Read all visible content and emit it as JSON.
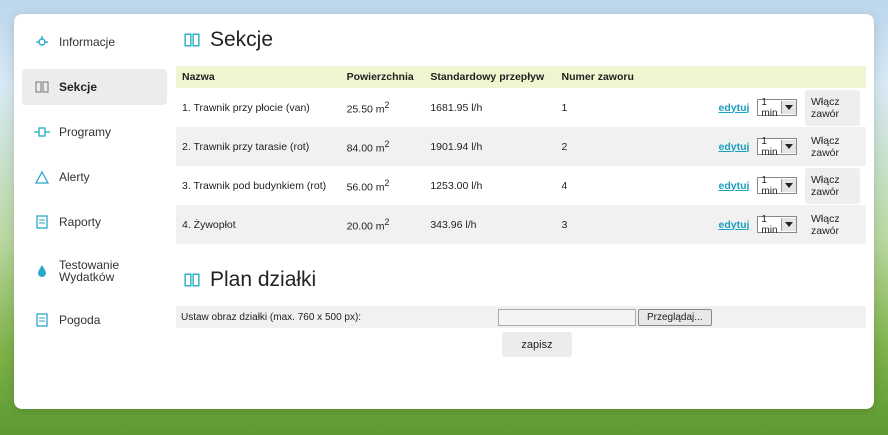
{
  "sidebar": {
    "items": [
      {
        "label": "Informacje",
        "icon": "info-icon"
      },
      {
        "label": "Sekcje",
        "icon": "sections-icon"
      },
      {
        "label": "Programy",
        "icon": "programs-icon"
      },
      {
        "label": "Alerty",
        "icon": "alert-icon"
      },
      {
        "label": "Raporty",
        "icon": "report-icon"
      },
      {
        "label": "Testowanie\nWydatków",
        "icon": "water-drop-icon"
      },
      {
        "label": "Pogoda",
        "icon": "weather-icon"
      }
    ]
  },
  "sections": {
    "title": "Sekcje",
    "columns": [
      "Nazwa",
      "Powierzchnia",
      "Standardowy przepływ",
      "Numer zaworu"
    ],
    "rows": [
      {
        "name": "1. Trawnik przy płocie (van)",
        "area": "25.50 m",
        "flow": "1681.95 l/h",
        "valve": "1",
        "edit": "edytuj",
        "duration": "1 min",
        "action": "Włącz zawór"
      },
      {
        "name": "2. Trawnik przy tarasie (rot)",
        "area": "84.00 m",
        "flow": "1901.94 l/h",
        "valve": "2",
        "edit": "edytuj",
        "duration": "1 min",
        "action": "Włącz zawór"
      },
      {
        "name": "3. Trawnik pod budynkiem (rot)",
        "area": "56.00 m",
        "flow": "1253.00 l/h",
        "valve": "4",
        "edit": "edytuj",
        "duration": "1 min",
        "action": "Włącz zawór"
      },
      {
        "name": "4. Żywopłot",
        "area": "20.00 m",
        "flow": "343.96 l/h",
        "valve": "3",
        "edit": "edytuj",
        "duration": "1 min",
        "action": "Włącz zawór"
      }
    ],
    "area_sup": "2"
  },
  "plan": {
    "title": "Plan działki",
    "upload_label": "Ustaw obraz działki (max. 760 x 500 px):",
    "browse_label": "Przeglądaj...",
    "save_label": "zapisz"
  },
  "colors": {
    "header_bg": "#eef5cf",
    "accent": "#1a9fbf"
  }
}
